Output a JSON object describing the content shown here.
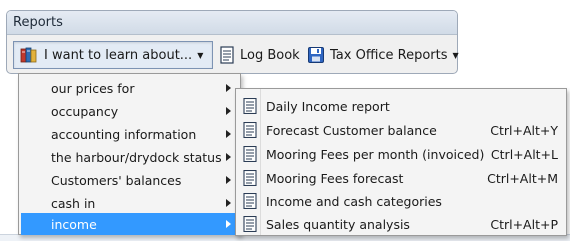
{
  "reports_panel": {
    "title": "Reports",
    "learn_button": {
      "label": "I want to learn about...",
      "icon": "books-icon"
    },
    "logbook_button": {
      "label": "Log Book",
      "icon": "document-icon"
    },
    "tax_button": {
      "label": "Tax Office Reports",
      "icon": "save-disk-icon"
    }
  },
  "learn_menu": {
    "items": [
      {
        "label": "our prices for"
      },
      {
        "label": "occupancy"
      },
      {
        "label": "accounting information"
      },
      {
        "label": "the harbour/drydock status"
      },
      {
        "label": "Customers' balances"
      },
      {
        "label": "cash in"
      },
      {
        "label": "income",
        "selected": true
      }
    ]
  },
  "income_submenu": {
    "items": [
      {
        "label": "Daily Income report",
        "shortcut": ""
      },
      {
        "label": "Forecast Customer balance",
        "shortcut": "Ctrl+Alt+Y"
      },
      {
        "label": "Mooring Fees per month (invoiced)",
        "shortcut": "Ctrl+Alt+L"
      },
      {
        "label": "Mooring Fees forecast",
        "shortcut": "Ctrl+Alt+M"
      },
      {
        "label": "Income and cash categories",
        "shortcut": ""
      },
      {
        "label": "Sales quantity analysis",
        "shortcut": "Ctrl+Alt+P"
      }
    ]
  },
  "colors": {
    "selection": "#3399ff",
    "panel_header": "#d1dbe7",
    "menu_background": "#f4f4f4"
  }
}
